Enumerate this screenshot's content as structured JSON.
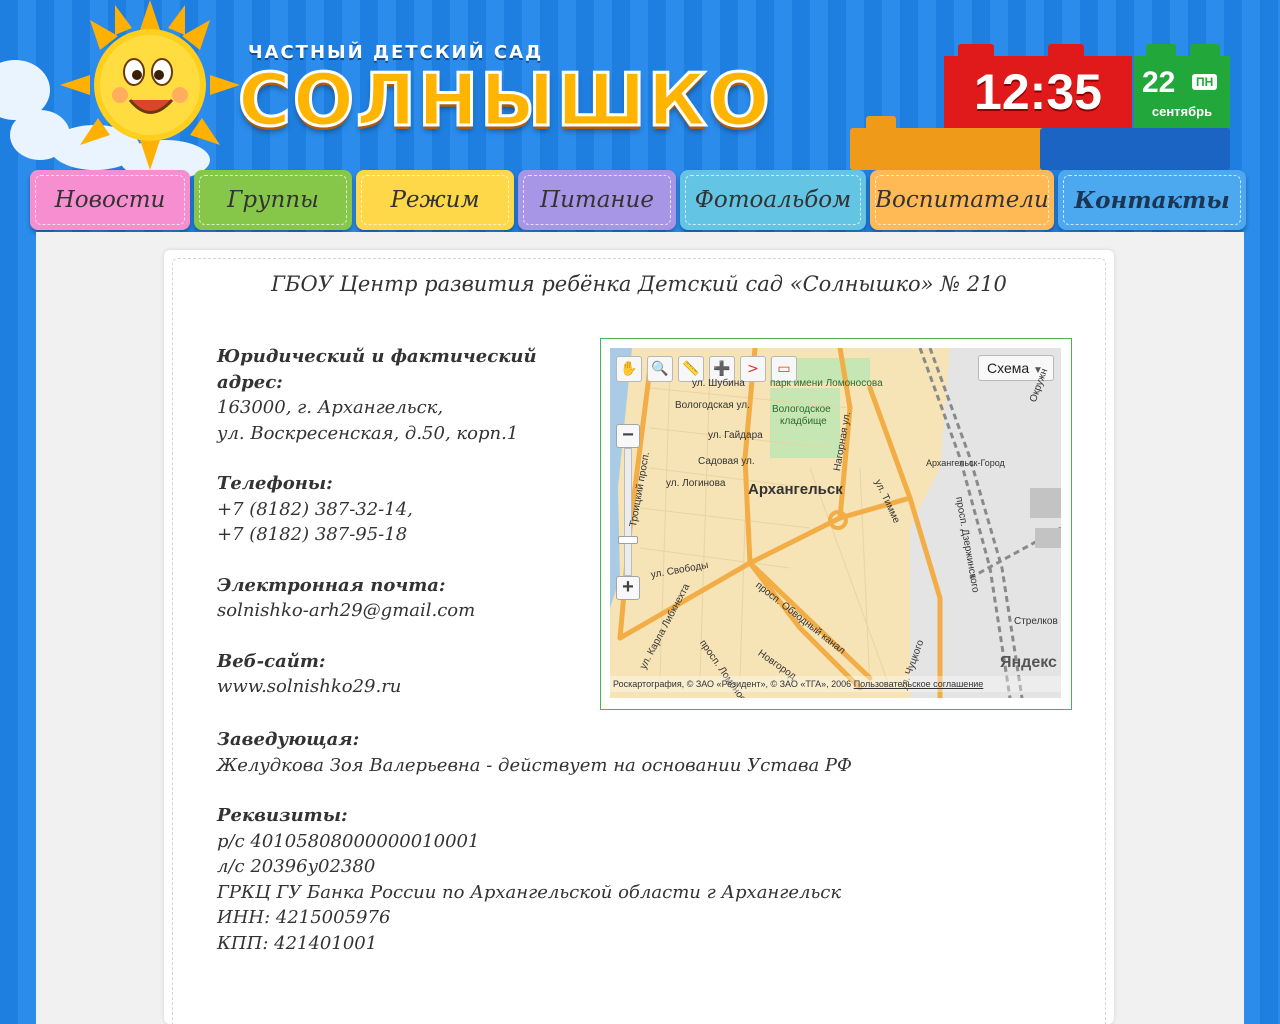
{
  "header": {
    "subtitle": "Частный детский сад",
    "title": "Солнышко"
  },
  "clock": {
    "time": "12:35",
    "day": "22",
    "weekday": "ПН",
    "month": "сентябрь"
  },
  "nav": [
    {
      "label": "Новости",
      "color": "#f78ed0",
      "active": false
    },
    {
      "label": "Группы",
      "color": "#86c74a",
      "active": false
    },
    {
      "label": "Режим",
      "color": "#ffd84a",
      "active": false
    },
    {
      "label": "Питание",
      "color": "#a795e6",
      "active": false
    },
    {
      "label": "Фотоальбом",
      "color": "#63c4e3",
      "active": false
    },
    {
      "label": "Воспитатели",
      "color": "#ffba55",
      "active": false
    },
    {
      "label": "Контакты",
      "color": "#4ca9f0",
      "active": true
    }
  ],
  "page_title": "ГБОУ Центр развития ребёнка Детский сад «Солнышко» № 210",
  "contacts": {
    "address_label": "Юридический и фактический адрес:",
    "address_line1": "163000, г. Архангельск,",
    "address_line2": "ул. Воскресенская, д.50, корп.1",
    "phones_label": "Телефоны:",
    "phone1": "+7 (8182) 387-32-14,",
    "phone2": "+7 (8182) 387-95-18",
    "email_label": "Электронная почта:",
    "email": "solnishko-arh29@gmail.com",
    "website_label": "Веб-сайт:",
    "website": "www.solnishko29.ru",
    "head_label": "Заведующая:",
    "head": "Желудкова Зоя Валерьевна - действует на основании Устава РФ",
    "requisites_label": "Реквизиты:",
    "req_account": "р/с 40105808000000010001",
    "req_personal": "л/с 20396у02380",
    "req_bank": "ГРКЦ ГУ Банка России по Архангельской области г Архангельск",
    "req_inn": "ИНН: 4215005976",
    "req_kpp": "КПП: 421401001"
  },
  "map": {
    "scheme_label": "Схема",
    "city_label": "Архангельск",
    "copyright": "Роскартография, © ЗАО «Резидент», © ЗАО «ТГА», 2006",
    "terms": "Пользовательское соглашение",
    "brand": "Яндекс",
    "labels": {
      "park": "парк имени Ломоносова",
      "cemetery1": "Вологодское",
      "cemetery2": "кладбище",
      "shubina": "ул. Шубина",
      "vologodskaya": "Вологодская ул.",
      "gaidara": "ул. Гайдара",
      "sadovaya": "Садовая ул.",
      "loginova": "ул. Логинова",
      "nagornaya": "Нагорная ул.",
      "timme": "ул. Тимме",
      "station": "Архангельск-Город",
      "svobody": "ул. Свободы",
      "obvodny": "просп. Обводный канал",
      "liebknecht": "ул. Карла Либкнехта",
      "troitsky": "Троицкий просп.",
      "lomonosova": "просп. Ломоносова",
      "dzerzhinskogo": "просп. Дзержинского",
      "okruzh": "Окружн",
      "strelkov": "Стрелков",
      "novgorod": "Новгород",
      "ulitskogo": "ул. Чуцкого"
    },
    "tools": [
      "hand-icon",
      "magnifier-icon",
      "ruler-icon",
      "placemark-icon",
      "polyline-icon",
      "polygon-icon"
    ]
  }
}
